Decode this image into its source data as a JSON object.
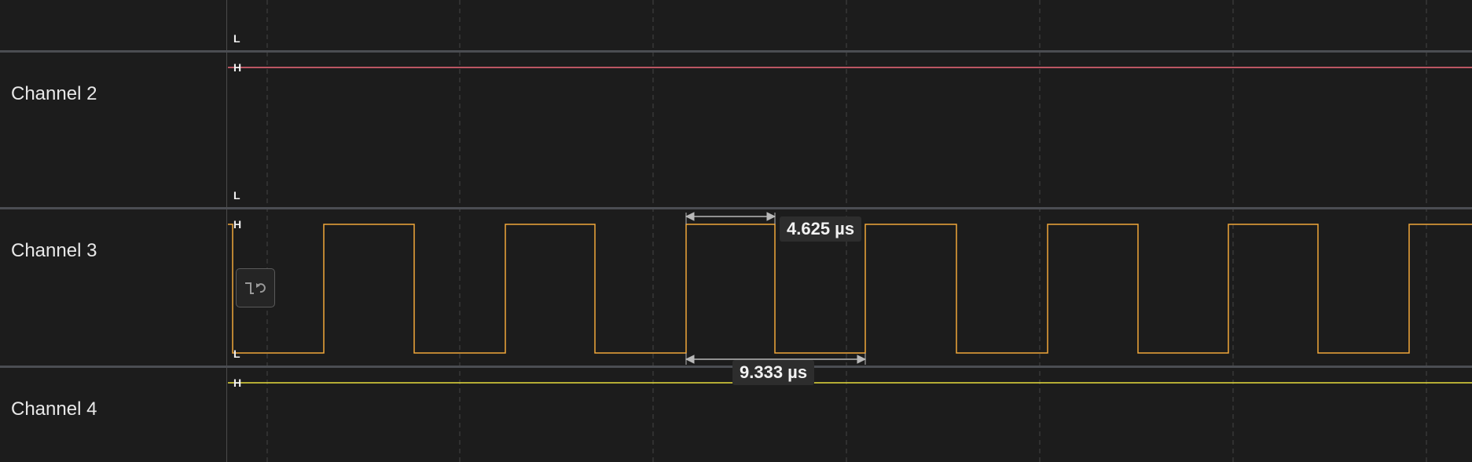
{
  "channels": [
    {
      "name": "Channel 2"
    },
    {
      "name": "Channel 3"
    },
    {
      "name": "Channel 4"
    }
  ],
  "level_labels": {
    "high": "H",
    "low": "L"
  },
  "measurements": {
    "pulse_width": "4.625 µs",
    "period": "9.333 µs"
  },
  "colors": {
    "background": "#1c1c1c",
    "channel2": "#f06a7a",
    "channel3": "#f0a63a",
    "channel4": "#e6dc3c",
    "separator": "#4b4d52",
    "grid": "#3c3c3c"
  },
  "icons": {
    "trigger_button": "falling-edge-trigger-icon"
  }
}
